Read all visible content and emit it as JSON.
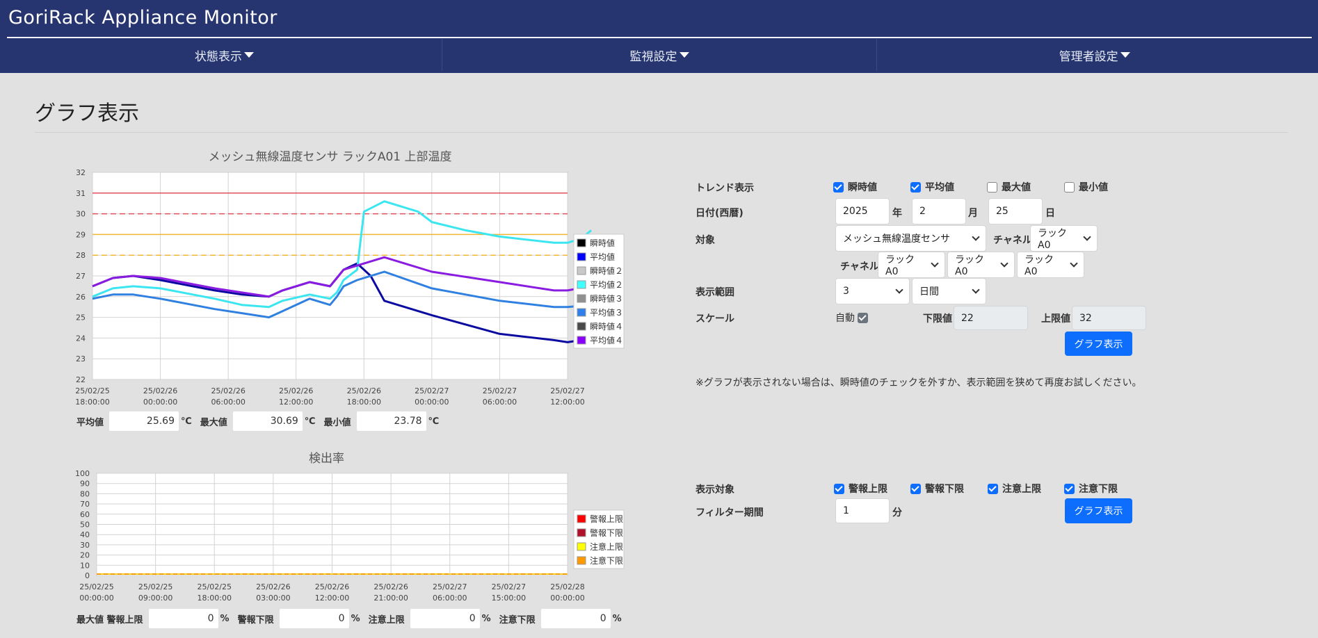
{
  "app": {
    "title": "GoriRack Appliance Monitor"
  },
  "nav": [
    {
      "label": "状態表示"
    },
    {
      "label": "監視設定"
    },
    {
      "label": "管理者設定"
    }
  ],
  "page": {
    "title": "グラフ表示"
  },
  "chart_temp": {
    "type": "line",
    "title": "メッシュ無線温度センサ ラックA01 上部温度",
    "ylim": [
      22,
      32
    ],
    "yticks": [
      "22",
      "23",
      "24",
      "25",
      "26",
      "27",
      "28",
      "29",
      "30",
      "31",
      "32"
    ],
    "x_labels": [
      [
        "25/02/25",
        "18:00:00"
      ],
      [
        "25/02/26",
        "00:00:00"
      ],
      [
        "25/02/26",
        "06:00:00"
      ],
      [
        "25/02/26",
        "12:00:00"
      ],
      [
        "25/02/26",
        "18:00:00"
      ],
      [
        "25/02/27",
        "00:00:00"
      ],
      [
        "25/02/27",
        "06:00:00"
      ],
      [
        "25/02/27",
        "12:00:00"
      ]
    ],
    "threshold_lines": [
      {
        "value": 31,
        "color": "#e0505a",
        "dash": false
      },
      {
        "value": 30,
        "color": "#e0505a",
        "dash": true
      },
      {
        "value": 29,
        "color": "#f0b830",
        "dash": false
      },
      {
        "value": 28,
        "color": "#f0b830",
        "dash": true
      }
    ],
    "legend": [
      {
        "name": "瞬時値",
        "color": "#000000"
      },
      {
        "name": "平均値",
        "color": "#0000ff"
      },
      {
        "name": "瞬時値２",
        "color": "#c8c8c8"
      },
      {
        "name": "平均値２",
        "color": "#40ffff"
      },
      {
        "name": "瞬時値３",
        "color": "#909090"
      },
      {
        "name": "平均値３",
        "color": "#2f80ed"
      },
      {
        "name": "瞬時値４",
        "color": "#4a4a4a"
      },
      {
        "name": "平均値４",
        "color": "#8a00ff"
      }
    ],
    "series": [
      {
        "name": "平均値",
        "color": "#0a0aa0",
        "x": [
          0,
          0.3,
          0.6,
          1.0,
          1.8,
          2.2,
          2.6,
          2.8,
          3.2,
          3.5,
          3.6,
          3.7,
          3.9,
          4.1,
          4.3,
          5.0,
          6.0,
          6.8,
          7.0,
          7.2,
          7.35
        ],
        "y": [
          26.5,
          26.9,
          27.0,
          26.8,
          26.3,
          26.1,
          26.0,
          26.3,
          26.7,
          26.5,
          26.9,
          27.3,
          27.6,
          27.0,
          25.8,
          25.1,
          24.2,
          23.9,
          23.8,
          23.9,
          24.3
        ]
      },
      {
        "name": "平均値２",
        "color": "#3ce6f0",
        "x": [
          0,
          0.3,
          0.6,
          1.0,
          1.8,
          2.2,
          2.6,
          2.8,
          3.2,
          3.5,
          3.6,
          3.7,
          3.9,
          4.0,
          4.3,
          4.8,
          5.0,
          5.5,
          6.0,
          6.8,
          7.0,
          7.2,
          7.35
        ],
        "y": [
          26.0,
          26.4,
          26.5,
          26.4,
          25.9,
          25.6,
          25.5,
          25.8,
          26.1,
          25.9,
          26.2,
          26.8,
          27.3,
          30.1,
          30.6,
          30.1,
          29.6,
          29.2,
          28.9,
          28.6,
          28.6,
          28.8,
          29.2
        ]
      },
      {
        "name": "平均値３",
        "color": "#2f80e0",
        "x": [
          0,
          0.3,
          0.6,
          1.0,
          1.8,
          2.2,
          2.6,
          2.8,
          3.2,
          3.5,
          3.6,
          3.7,
          3.9,
          4.3,
          5.0,
          6.0,
          6.8,
          7.0,
          7.35
        ],
        "y": [
          25.9,
          26.1,
          26.1,
          25.9,
          25.4,
          25.2,
          25.0,
          25.3,
          25.9,
          25.6,
          26.0,
          26.5,
          26.8,
          27.2,
          26.4,
          25.8,
          25.5,
          25.5,
          25.6
        ]
      },
      {
        "name": "平均値４",
        "color": "#8a1be0",
        "x": [
          0,
          0.3,
          0.6,
          1.0,
          1.8,
          2.2,
          2.6,
          2.8,
          3.2,
          3.5,
          3.6,
          3.7,
          3.9,
          4.3,
          5.0,
          6.0,
          6.8,
          7.0,
          7.35
        ],
        "y": [
          26.5,
          26.9,
          27.0,
          26.9,
          26.4,
          26.2,
          26.0,
          26.3,
          26.7,
          26.5,
          26.9,
          27.3,
          27.5,
          27.9,
          27.2,
          26.7,
          26.3,
          26.3,
          26.5
        ]
      }
    ]
  },
  "stats_temp": {
    "avg_label": "平均値",
    "avg_value": "25.69",
    "max_label": "最大値",
    "max_value": "30.69",
    "min_label": "最小値",
    "min_value": "23.78",
    "unit": "℃"
  },
  "chart_rate": {
    "type": "line",
    "title": "検出率",
    "ylim": [
      0,
      100
    ],
    "yticks": [
      "0",
      "10",
      "20",
      "30",
      "40",
      "50",
      "60",
      "70",
      "80",
      "90",
      "100"
    ],
    "x_labels": [
      [
        "25/02/25",
        "00:00:00"
      ],
      [
        "25/02/25",
        "09:00:00"
      ],
      [
        "25/02/25",
        "18:00:00"
      ],
      [
        "25/02/26",
        "03:00:00"
      ],
      [
        "25/02/26",
        "12:00:00"
      ],
      [
        "25/02/26",
        "21:00:00"
      ],
      [
        "25/02/27",
        "06:00:00"
      ],
      [
        "25/02/27",
        "15:00:00"
      ],
      [
        "25/02/28",
        "00:00:00"
      ]
    ],
    "legend": [
      {
        "name": "警報上限",
        "color": "#ff0000"
      },
      {
        "name": "警報下限",
        "color": "#b0102a"
      },
      {
        "name": "注意上限",
        "color": "#ffff00"
      },
      {
        "name": "注意下限",
        "color": "#ff9900"
      }
    ],
    "series": [
      {
        "name": "警報上限",
        "value": 0
      },
      {
        "name": "警報下限",
        "value": 0
      },
      {
        "name": "注意上限",
        "value": 0
      },
      {
        "name": "注意下限",
        "value": 0
      }
    ]
  },
  "stats_rate": {
    "l1": "最大値 警報上限",
    "v1": "0",
    "l2": "警報下限",
    "v2": "0",
    "l3": "注意上限",
    "v3": "0",
    "l4": "注意下限",
    "v4": "0",
    "unit": "%"
  },
  "form1": {
    "trend_label": "トレンド表示",
    "cb_instant": "瞬時値",
    "cb_avg": "平均値",
    "cb_max": "最大値",
    "cb_min": "最小値",
    "date_label": "日付(西暦)",
    "year": "2025",
    "year_unit": "年",
    "month": "2",
    "month_unit": "月",
    "day": "25",
    "day_unit": "日",
    "target_label": "対象",
    "target_value": "メッシュ無線温度センサ",
    "channel_label": "チャネル",
    "channel_value": "ラックA0",
    "channel2_label": "チャネル",
    "channel2_values": [
      "ラックA0",
      "ラックA0",
      "ラックA0"
    ],
    "range_label": "表示範囲",
    "range_value": "3",
    "range_unit_value": "日間",
    "scale_label": "スケール",
    "auto_label": "自動",
    "lower_label": "下限値",
    "lower_value": "22",
    "upper_label": "上限値",
    "upper_value": "32",
    "button": "グラフ表示",
    "note": "※グラフが表示されない場合は、瞬時値のチェックを外すか、表示範囲を狭めて再度お試しください。"
  },
  "form2": {
    "target_label": "表示対象",
    "cb1": "警報上限",
    "cb2": "警報下限",
    "cb3": "注意上限",
    "cb4": "注意下限",
    "filter_label": "フィルター期間",
    "filter_value": "1",
    "filter_unit": "分",
    "button": "グラフ表示"
  }
}
